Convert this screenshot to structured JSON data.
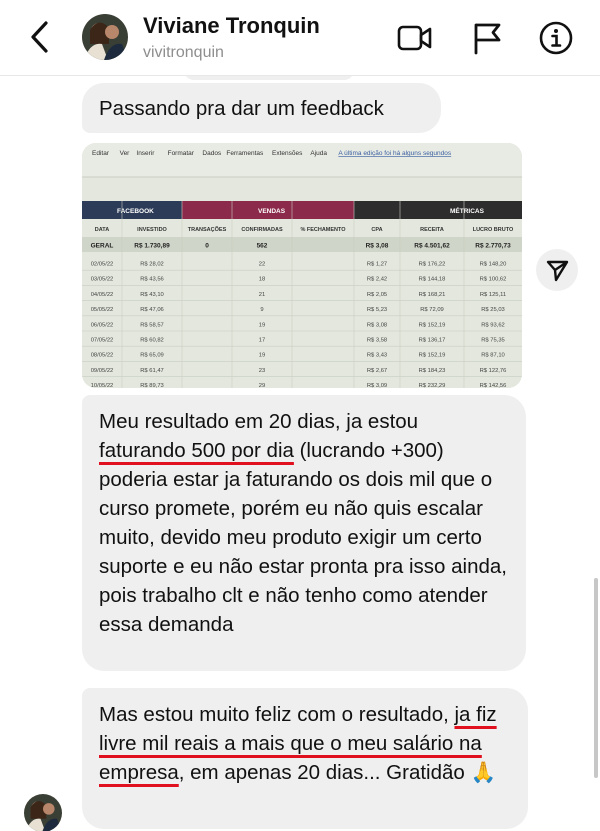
{
  "header": {
    "name": "Viviane Tronquin",
    "username": "vivitronquin",
    "back_icon": "chevron-left-icon",
    "video_icon": "video-call-icon",
    "flag_icon": "flag-icon",
    "info_icon": "info-icon"
  },
  "messages": {
    "m1": "Passando pra dar um feedback",
    "m2": {
      "pre": "Meu resultado em 20 dias, ja estou ",
      "highlight": "faturando 500 por dia",
      "post": " (lucrando +300) poderia estar ja faturando os dois mil que o curso promete, porém eu não quis escalar muito, devido meu produto exigir um certo suporte e eu não estar pronta pra isso ainda, pois trabalho clt e não tenho como atender essa demanda"
    },
    "m3": {
      "pre": "Mas estou muito feliz com o resultado, ",
      "highlight": "ja fiz livre mil reais a mais que o meu salário na empresa",
      "post": ", em apenas 20 dias... Gratidão 🙏"
    }
  },
  "sheet": {
    "menu": [
      "Editar",
      "Ver",
      "Inserir",
      "Formatar",
      "Dados",
      "Ferramentas",
      "Extensões",
      "Ajuda"
    ],
    "last_edit": "A última edição foi há alguns segundos",
    "group_facebook": "FACEBOOK",
    "group_vendas": "VENDAS",
    "group_metricas": "MÉTRICAS",
    "columns": [
      "DATA",
      "INVESTIDO",
      "TRANSAÇÕES",
      "CONFIRMADAS",
      "% FECHAMENTO",
      "CPA",
      "RECEITA",
      "LUCRO BRUTO"
    ],
    "total": [
      "GERAL",
      "R$ 1.730,89",
      "0",
      "562",
      "",
      "R$ 3,08",
      "R$ 4.501,62",
      "R$ 2.770,73"
    ],
    "rows": [
      [
        "02/05/22",
        "R$ 28,02",
        "",
        "22",
        "",
        "R$ 1,27",
        "R$ 176,22",
        "R$ 148,20"
      ],
      [
        "03/05/22",
        "R$ 43,56",
        "",
        "18",
        "",
        "R$ 2,42",
        "R$ 144,18",
        "R$ 100,62"
      ],
      [
        "04/05/22",
        "R$ 43,10",
        "",
        "21",
        "",
        "R$ 2,05",
        "R$ 168,21",
        "R$ 125,11"
      ],
      [
        "05/05/22",
        "R$ 47,06",
        "",
        "9",
        "",
        "R$ 5,23",
        "R$ 72,09",
        "R$ 25,03"
      ],
      [
        "06/05/22",
        "R$ 58,57",
        "",
        "19",
        "",
        "R$ 3,08",
        "R$ 152,19",
        "R$ 93,62"
      ],
      [
        "07/05/22",
        "R$ 60,82",
        "",
        "17",
        "",
        "R$ 3,58",
        "R$ 136,17",
        "R$ 75,35"
      ],
      [
        "08/05/22",
        "R$ 65,09",
        "",
        "19",
        "",
        "R$ 3,43",
        "R$ 152,19",
        "R$ 87,10"
      ],
      [
        "09/05/22",
        "R$ 61,47",
        "",
        "23",
        "",
        "R$ 2,67",
        "R$ 184,23",
        "R$ 122,76"
      ],
      [
        "10/05/22",
        "R$ 89,73",
        "",
        "29",
        "",
        "R$ 3,09",
        "R$ 232,29",
        "R$ 142,56"
      ]
    ]
  },
  "share_icon": "send-icon"
}
